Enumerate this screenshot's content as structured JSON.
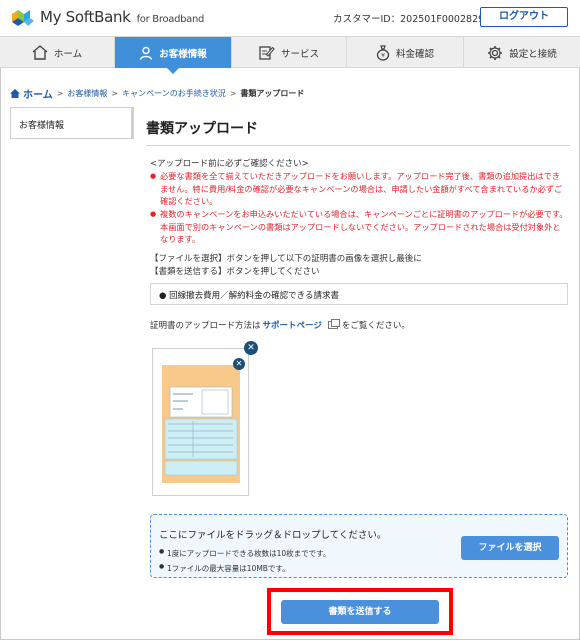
{
  "header": {
    "brand": "My SoftBank",
    "brand_sub": "for Broadband",
    "customer_id": "カスタマーID：202501F0002829",
    "logout_label": "ログアウト"
  },
  "nav": {
    "items": [
      {
        "label": "ホーム",
        "icon": "home-icon"
      },
      {
        "label": "お客様情報",
        "icon": "user-icon"
      },
      {
        "label": "サービス",
        "icon": "edit-icon"
      },
      {
        "label": "料金確認",
        "icon": "money-bag-icon"
      },
      {
        "label": "設定と接続",
        "icon": "gear-icon"
      }
    ],
    "active_index": 1,
    "active_color": "#3f8fd9"
  },
  "breadcrumb": {
    "home": "ホーム",
    "items": [
      "お客様情報",
      "キャンペーンのお手続き状況"
    ],
    "current": "書類アップロード",
    "separator": ">"
  },
  "sidebar": {
    "item": "お客様情報"
  },
  "main": {
    "title": "書類アップロード",
    "notice_head": "<アップロード前に必ずご確認ください>",
    "notices": [
      "必要な書類を全て揃えていただきアップロードをお願いします。アップロード完了後、書類の追加提出はできません。特に費用/料金の確認が必要なキャンペーンの場合は、申請したい金額がすべて含まれているか必ずご確認ください。",
      "複数のキャンペーンをお申込みいただいている場合は、キャンペーンごとに証明書のアップロードが必要です。本画面で別のキャンペーンの書類はアップロードしないでください。アップロードされた場合は受付対象外となります。"
    ],
    "notice_color": "#e0262d",
    "instructions": [
      "【ファイルを選択】ボタンを押して以下の証明書の画像を選択し最後に",
      "【書類を送信する】ボタンを押してください"
    ],
    "required_doc": "● 回線撤去費用／解約料金の確認できる請求書",
    "support_before": "証明書のアップロード方法は",
    "support_link": "サポートページ",
    "support_after": "をご覧ください。"
  },
  "dropzone": {
    "title": "ここにファイルをドラッグ＆ドロップしてください。",
    "notes": [
      "1度にアップロードできる枚数は10枚までです。",
      "1ファイルの最大容量は10MBです。"
    ],
    "select_label": "ファイルを選択"
  },
  "submit": {
    "label": "書類を送信する",
    "highlight_color": "#ff0000"
  },
  "thumbnail": {
    "close_icon": "close-icon"
  }
}
